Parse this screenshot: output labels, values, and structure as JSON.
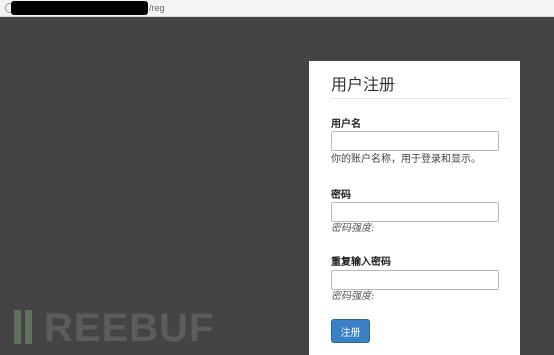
{
  "browser": {
    "url_path": "/reg"
  },
  "form": {
    "title": "用户注册",
    "username": {
      "label": "用户名",
      "value": "",
      "help": "你的账户名称，用于登录和显示。"
    },
    "password": {
      "label": "密码",
      "value": "",
      "strength": "密码强度:"
    },
    "confirm_password": {
      "label": "重复输入密码",
      "value": "",
      "strength": "密码强度:"
    },
    "submit_label": "注册"
  },
  "watermark": {
    "text": "REEBUF"
  },
  "colors": {
    "background": "#444444",
    "panel": "#ffffff",
    "button": "#3b7fc4"
  }
}
